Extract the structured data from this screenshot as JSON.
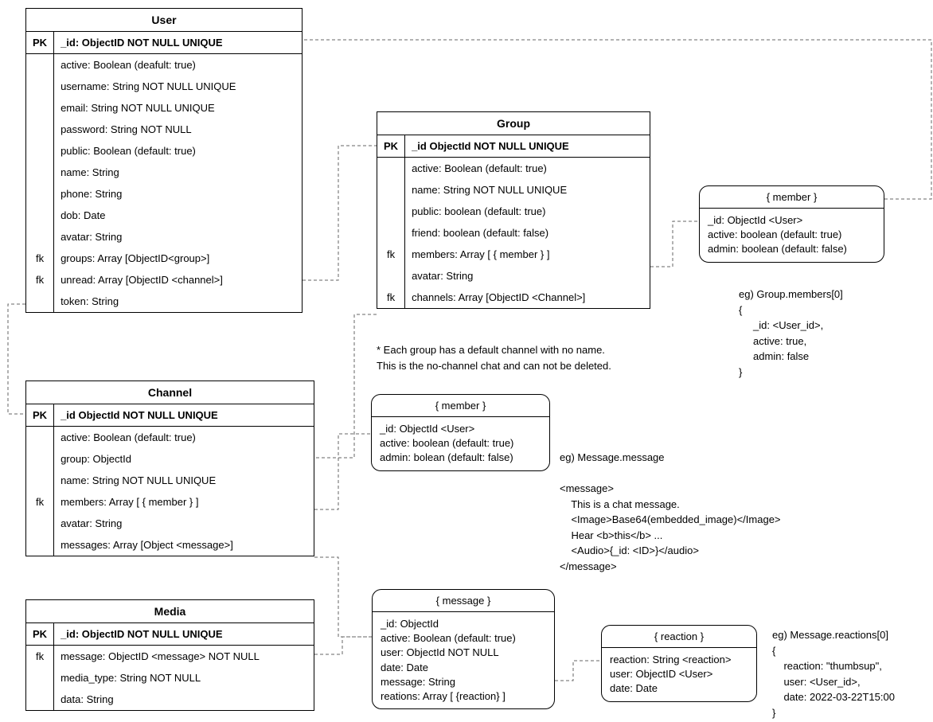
{
  "entities": {
    "user": {
      "title": "User",
      "pk_row": {
        "key": "PK",
        "text": "_id: ObjectID NOT NULL UNIQUE"
      },
      "rows": [
        {
          "key": "",
          "text": "active: Boolean (deafult: true)"
        },
        {
          "key": "",
          "text": "username: String NOT NULL UNIQUE"
        },
        {
          "key": "",
          "text": "email: String NOT NULL UNIQUE"
        },
        {
          "key": "",
          "text": "password: String NOT NULL"
        },
        {
          "key": "",
          "text": "public: Boolean (default: true)"
        },
        {
          "key": "",
          "text": "name: String"
        },
        {
          "key": "",
          "text": "phone: String"
        },
        {
          "key": "",
          "text": "dob: Date"
        },
        {
          "key": "",
          "text": "avatar: String"
        },
        {
          "key": "fk",
          "text": "groups: Array [ObjectID<group>]"
        },
        {
          "key": "fk",
          "text": "unread: Array [ObjectID <channel>]"
        },
        {
          "key": "",
          "text": "token: String"
        }
      ]
    },
    "group": {
      "title": "Group",
      "pk_row": {
        "key": "PK",
        "text": "_id ObjectId NOT NULL UNIQUE"
      },
      "rows": [
        {
          "key": "",
          "text": "active: Boolean (default: true)"
        },
        {
          "key": "",
          "text": "name: String NOT NULL UNIQUE"
        },
        {
          "key": "",
          "text": "public: boolean (default: true)"
        },
        {
          "key": "",
          "text": "friend: boolean (default: false)"
        },
        {
          "key": "fk",
          "text": "members: Array [ { member } ]"
        },
        {
          "key": "",
          "text": "avatar: String"
        },
        {
          "key": "fk",
          "text": "channels: Array [ObjectID <Channel>]"
        }
      ]
    },
    "channel": {
      "title": "Channel",
      "pk_row": {
        "key": "PK",
        "text": "_id ObjectId NOT NULL UNIQUE"
      },
      "rows": [
        {
          "key": "",
          "text": "active: Boolean (default: true)"
        },
        {
          "key": "",
          "text": "group: ObjectId"
        },
        {
          "key": "",
          "text": "name: String NOT NULL UNIQUE"
        },
        {
          "key": "fk",
          "text": "members: Array [ { member } ]"
        },
        {
          "key": "",
          "text": "avatar: String"
        },
        {
          "key": "",
          "text": "messages: Array [Object <message>]"
        }
      ]
    },
    "media": {
      "title": "Media",
      "pk_row": {
        "key": "PK",
        "text": "_id: ObjectID NOT NULL UNIQUE"
      },
      "rows": [
        {
          "key": "fk",
          "text": "message: ObjectID <message> NOT NULL"
        },
        {
          "key": "",
          "text": "media_type: String NOT NULL"
        },
        {
          "key": "",
          "text": "data: String"
        }
      ]
    }
  },
  "boxes": {
    "member_top": {
      "title": "{ member }",
      "lines": [
        "_id: ObjectId <User>",
        "active: boolean (default: true)",
        "admin: boolean (default: false)"
      ]
    },
    "member_mid": {
      "title": "{ member }",
      "lines": [
        "_id: ObjectId <User>",
        "active: boolean (default: true)",
        "admin: bolean (default: false)"
      ]
    },
    "message": {
      "title": "{ message }",
      "lines": [
        "_id: ObjectId",
        "active: Boolean (default: true)",
        "user: ObjectId NOT NULL",
        "date: Date",
        "message: String",
        "reations: Array [ {reaction} ]"
      ]
    },
    "reaction": {
      "title": "{ reaction }",
      "lines": [
        "reaction: String <reaction>",
        "user: ObjectID <User>",
        "date: Date"
      ]
    }
  },
  "notes": {
    "group_note": "* Each group has a default channel with no name.\nThis is the no-channel chat and can not be deleted.",
    "member_eg": "eg) Group.members[0]\n{\n     _id: <User_id>,\n     active: true,\n     admin: false\n}",
    "message_eg": "eg) Message.message\n\n<message>\n    This is a chat message.\n    <Image>Base64(embedded_image)</Image>\n    Hear <b>this</b> ...\n    <Audio>{_id: <ID>}</audio>\n</message>",
    "reaction_eg": "eg) Message.reactions[0]\n{\n    reaction: \"thumbsup\",\n    user: <User_id>,\n    date: 2022-03-22T15:00\n}"
  },
  "chart_data": {
    "type": "er-diagram",
    "entities": [
      {
        "name": "User",
        "primary_key": "_id: ObjectID NOT NULL UNIQUE",
        "attributes": [
          "active: Boolean (deafult: true)",
          "username: String NOT NULL UNIQUE",
          "email: String NOT NULL UNIQUE",
          "password: String NOT NULL",
          "public: Boolean (default: true)",
          "name: String",
          "phone: String",
          "dob: Date",
          "avatar: String",
          "groups: Array [ObjectID<group>] (fk)",
          "unread: Array [ObjectID <channel>] (fk)",
          "token: String"
        ]
      },
      {
        "name": "Group",
        "primary_key": "_id ObjectId NOT NULL UNIQUE",
        "attributes": [
          "active: Boolean (default: true)",
          "name: String NOT NULL UNIQUE",
          "public: boolean (default: true)",
          "friend: boolean (default: false)",
          "members: Array [ { member } ] (fk)",
          "avatar: String",
          "channels: Array [ObjectID <Channel>] (fk)"
        ]
      },
      {
        "name": "Channel",
        "primary_key": "_id ObjectId NOT NULL UNIQUE",
        "attributes": [
          "active: Boolean (default: true)",
          "group: ObjectId",
          "name: String NOT NULL UNIQUE",
          "members: Array [ { member } ] (fk)",
          "avatar: String",
          "messages: Array [Object <message>]"
        ]
      },
      {
        "name": "Media",
        "primary_key": "_id: ObjectID NOT NULL UNIQUE",
        "attributes": [
          "message: ObjectID <message> NOT NULL (fk)",
          "media_type: String NOT NULL",
          "data: String"
        ]
      }
    ],
    "sub_objects": [
      {
        "name": "member",
        "fields": [
          "_id: ObjectId <User>",
          "active: boolean (default: true)",
          "admin: boolean (default: false)"
        ]
      },
      {
        "name": "message",
        "fields": [
          "_id: ObjectId",
          "active: Boolean (default: true)",
          "user: ObjectId NOT NULL",
          "date: Date",
          "message: String",
          "reations: Array [ {reaction} ]"
        ]
      },
      {
        "name": "reaction",
        "fields": [
          "reaction: String <reaction>",
          "user: ObjectID <User>",
          "date: Date"
        ]
      }
    ],
    "relationships": [
      {
        "from": "User.groups",
        "to": "Group._id"
      },
      {
        "from": "User.unread",
        "to": "Channel._id"
      },
      {
        "from": "Group.members",
        "to": "member"
      },
      {
        "from": "Group.channels",
        "to": "Channel._id"
      },
      {
        "from": "Channel.members",
        "to": "member"
      },
      {
        "from": "Channel.messages",
        "to": "message"
      },
      {
        "from": "Media.message",
        "to": "message"
      },
      {
        "from": "message.reations",
        "to": "reaction"
      },
      {
        "from": "member._id",
        "to": "User._id"
      },
      {
        "from": "reaction.user",
        "to": "User._id"
      }
    ]
  }
}
